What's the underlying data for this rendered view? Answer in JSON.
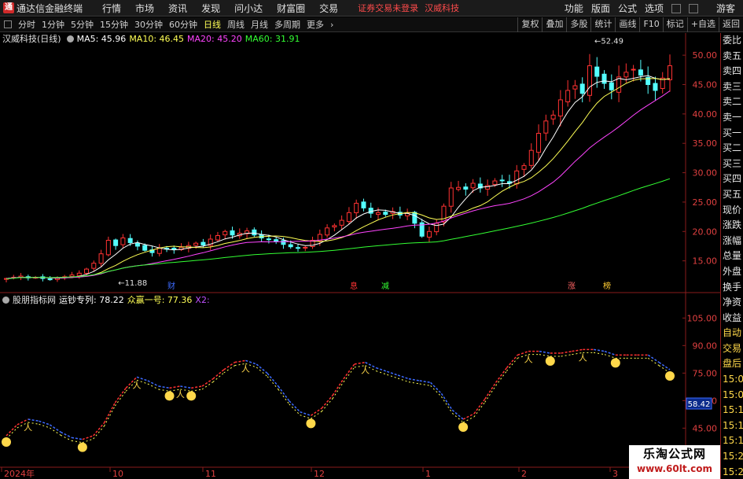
{
  "menubar": {
    "logo": "通",
    "app_title": "通达信金融终端",
    "items": [
      "行情",
      "市场",
      "资讯",
      "发现",
      "问小达",
      "财富圈",
      "交易"
    ],
    "notice": "证券交易未登录",
    "stock": "汉威科技",
    "right": [
      "功能",
      "版面",
      "公式",
      "选项"
    ],
    "guest": "游客"
  },
  "toolbar": {
    "periods": [
      "分时",
      "1分钟",
      "5分钟",
      "15分钟",
      "30分钟",
      "60分钟",
      "日线",
      "周线",
      "月线",
      "多周期",
      "更多"
    ],
    "active": "日线",
    "right": [
      "复权",
      "叠加",
      "多股",
      "统计",
      "画线",
      "F10",
      "标记",
      "+自选",
      "返回"
    ]
  },
  "main_info": {
    "stock_label": "汉威科技(日线)",
    "ma5": "MA5: 45.96",
    "ma10": "MA10: 46.45",
    "ma20": "MA20: 45.20",
    "ma60": "MA60: 31.91",
    "colors": {
      "ma5": "#ffffff",
      "ma10": "#ffff55",
      "ma20": "#ff44ff",
      "ma60": "#33ff33"
    }
  },
  "sub_info": {
    "name": "股朋指标网",
    "s1": "运钞专列: 78.22",
    "s2": "众赢一号: 77.36",
    "s3": "X2:"
  },
  "sidebar": {
    "items": [
      "委比",
      "卖五",
      "卖四",
      "卖三",
      "卖二",
      "卖一",
      "买一",
      "买二",
      "买三",
      "买四",
      "买五",
      "现价",
      "涨跌",
      "涨幅",
      "总量",
      "外盘",
      "换手",
      "净资",
      "收益",
      "自动",
      "交易",
      "盘后",
      "15:00",
      "15:05",
      "15:10",
      "15:11",
      "15:15",
      "15:20",
      "15:25",
      "15:30"
    ]
  },
  "watermark": {
    "line1": "乐淘公式网",
    "line2": "www.60lt.com"
  },
  "chart_data": [
    {
      "type": "candlestick",
      "title": "汉威科技(日线)",
      "y_ticks": [
        15.0,
        20.0,
        25.0,
        30.0,
        35.0,
        40.0,
        45.0,
        50.0
      ],
      "ylim": [
        10.0,
        53.5
      ],
      "annotations": {
        "high": "52.49",
        "low": "11.88"
      },
      "event_markers": [
        "财",
        "息",
        "减",
        "涨",
        "榜"
      ],
      "close": [
        12.0,
        12.2,
        12.4,
        12.1,
        12.2,
        12.0,
        11.9,
        12.1,
        12.3,
        12.6,
        12.9,
        13.6,
        14.6,
        16.2,
        18.5,
        17.6,
        18.9,
        18.1,
        17.5,
        16.8,
        16.4,
        17.2,
        17.0,
        16.9,
        17.3,
        17.6,
        18.0,
        17.7,
        18.7,
        19.3,
        20.0,
        19.4,
        19.7,
        20.1,
        19.4,
        18.9,
        18.6,
        18.3,
        17.8,
        17.4,
        17.2,
        17.3,
        18.5,
        19.5,
        20.6,
        21.0,
        21.9,
        23.2,
        24.8,
        24.0,
        23.1,
        23.2,
        22.9,
        23.4,
        22.8,
        23.1,
        21.4,
        19.2,
        20.0,
        21.4,
        24.3,
        27.4,
        27.5,
        27.2,
        28.2,
        27.4,
        27.8,
        28.6,
        28.7,
        28.2,
        30.3,
        31.2,
        33.8,
        36.7,
        38.8,
        39.8,
        42.4,
        44.0,
        44.8,
        43.5,
        48.2,
        46.4,
        45.2,
        44.1,
        46.3,
        47.1,
        47.6,
        46.6,
        45.0,
        44.0,
        46.1,
        48.2
      ],
      "series": [
        {
          "name": "MA5",
          "color": "#ffffff"
        },
        {
          "name": "MA10",
          "color": "#ffff55"
        },
        {
          "name": "MA20",
          "color": "#ff44ff"
        },
        {
          "name": "MA60",
          "color": "#33ff33"
        }
      ],
      "x_ticks": [
        "2024年",
        "10",
        "11",
        "12",
        "1",
        "2",
        "3"
      ]
    },
    {
      "type": "line",
      "title": "股朋指标网",
      "series": [
        {
          "name": "运钞专列",
          "value": 78.22
        },
        {
          "name": "众赢一号",
          "value": 77.36
        }
      ],
      "y_ticks": [
        30.0,
        45.0,
        60.0,
        75.0,
        90.0,
        105.0
      ],
      "ylim": [
        25.0,
        112.0
      ],
      "current_value": "58.42",
      "values": [
        40,
        46,
        49,
        48,
        46,
        42,
        39,
        38,
        40,
        47,
        58,
        66,
        72,
        70,
        67,
        66,
        67,
        66,
        67,
        71,
        76,
        80,
        81,
        79,
        74,
        67,
        59,
        53,
        51,
        55,
        62,
        71,
        79,
        80,
        77,
        75,
        73,
        71,
        70,
        69,
        63,
        54,
        49,
        52,
        60,
        69,
        77,
        84,
        86,
        86,
        85,
        85,
        86,
        87,
        87,
        86,
        84,
        84,
        84,
        84,
        80,
        76
      ]
    }
  ]
}
